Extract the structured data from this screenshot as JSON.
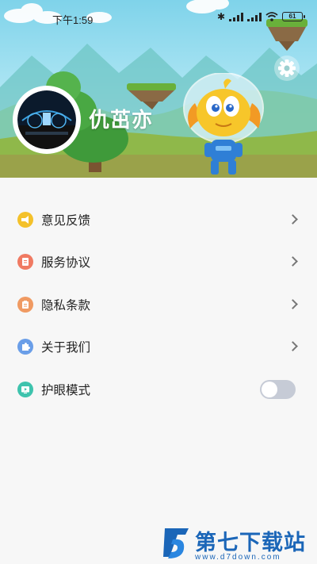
{
  "status_bar": {
    "time": "下午1:59",
    "battery": "61",
    "icons": [
      "bluetooth-icon",
      "signal-icon",
      "signal-icon",
      "wifi-icon",
      "battery-icon"
    ]
  },
  "profile": {
    "username": "仇茁亦"
  },
  "settings_icon": "gear-icon",
  "menu": {
    "items": [
      {
        "label": "意见反馈",
        "icon": "megaphone-icon",
        "color": "#f4c12a"
      },
      {
        "label": "服务协议",
        "icon": "document-icon",
        "color": "#f07a62"
      },
      {
        "label": "隐私条款",
        "icon": "clipboard-icon",
        "color": "#f09a62"
      },
      {
        "label": "关于我们",
        "icon": "puzzle-icon",
        "color": "#6a9ee8"
      },
      {
        "label": "护眼模式",
        "icon": "tv-icon",
        "color": "#3ec3ad"
      }
    ],
    "eye_mode_on": false
  },
  "watermark": {
    "title": "第七下载站",
    "url": "www.d7down.com"
  }
}
